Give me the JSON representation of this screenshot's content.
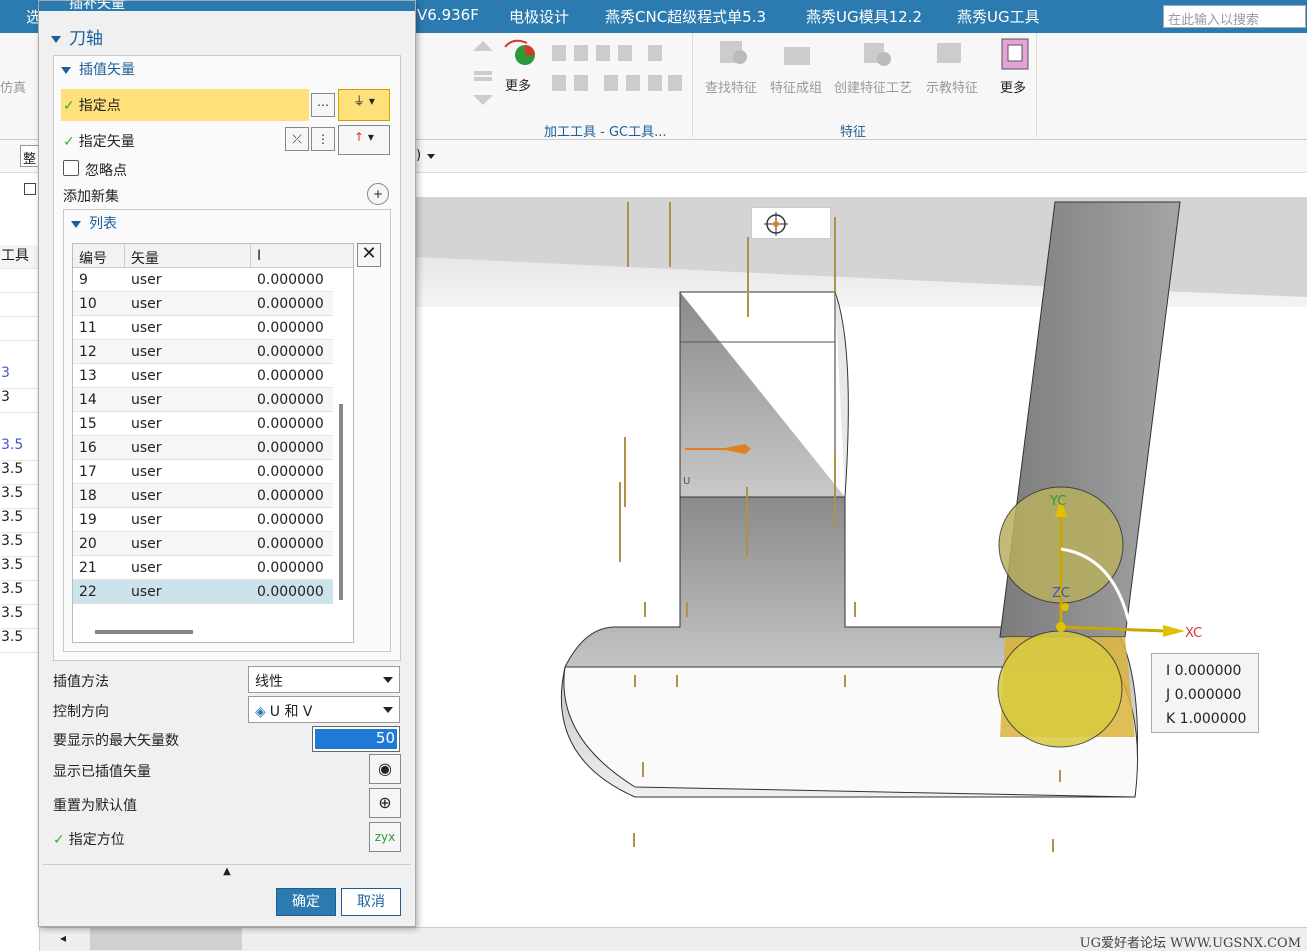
{
  "menubar": {
    "left_partial": "选",
    "items": [
      "V6.936F",
      "电极设计",
      "燕秀CNC超级程式单5.3",
      "燕秀UG模具12.2",
      "燕秀UG工具"
    ],
    "search_placeholder": "在此输入以搜索"
  },
  "ribbon": {
    "left_partial_label": "仿真",
    "more_label": "更多",
    "group_machining": "加工工具 - GC工具...",
    "feature_buttons": [
      "查找特征",
      "特征成组",
      "创建特征工艺",
      "示教特征"
    ],
    "feature_more": "更多",
    "group_feature": "特征"
  },
  "toolbar2": {
    "partial_label": "整",
    "right_partial": ")"
  },
  "left_strip": {
    "header": "工具",
    "values": [
      "3",
      "3",
      "3.5",
      "3.5",
      "3.5",
      "3.5",
      "3.5",
      "3.5",
      "3.5",
      "3.5",
      "3.5"
    ]
  },
  "dialog": {
    "title": "插补矢量",
    "section_tool_axis": "刀轴",
    "section_interp": "插值矢量",
    "specify_point": "指定点",
    "specify_vector": "指定矢量",
    "ignore_point": "忽略点",
    "add_new_set": "添加新集",
    "list_label": "列表",
    "columns": [
      "编号",
      "矢量",
      "I"
    ],
    "rows": [
      {
        "no": "9",
        "vec": "user",
        "i": "0.000000"
      },
      {
        "no": "10",
        "vec": "user",
        "i": "0.000000"
      },
      {
        "no": "11",
        "vec": "user",
        "i": "0.000000"
      },
      {
        "no": "12",
        "vec": "user",
        "i": "0.000000"
      },
      {
        "no": "13",
        "vec": "user",
        "i": "0.000000"
      },
      {
        "no": "14",
        "vec": "user",
        "i": "0.000000"
      },
      {
        "no": "15",
        "vec": "user",
        "i": "0.000000"
      },
      {
        "no": "16",
        "vec": "user",
        "i": "0.000000"
      },
      {
        "no": "17",
        "vec": "user",
        "i": "0.000000"
      },
      {
        "no": "18",
        "vec": "user",
        "i": "0.000000"
      },
      {
        "no": "19",
        "vec": "user",
        "i": "0.000000"
      },
      {
        "no": "20",
        "vec": "user",
        "i": "0.000000"
      },
      {
        "no": "21",
        "vec": "user",
        "i": "0.000000"
      },
      {
        "no": "22",
        "vec": "user",
        "i": "0.000000"
      }
    ],
    "selected_row": "22",
    "interp_method_label": "插值方法",
    "interp_method_value": "线性",
    "control_dir_label": "控制方向",
    "control_dir_value": "U 和 V",
    "max_vectors_label": "要显示的最大矢量数",
    "max_vectors_value": "50",
    "show_interp_label": "显示已插值矢量",
    "reset_label": "重置为默认值",
    "specify_orient_label": "指定方位",
    "ok": "确定",
    "cancel": "取消"
  },
  "viewport": {
    "axis_labels": {
      "yc": "YC",
      "zc": "ZC",
      "xc": "XC",
      "u": "U"
    },
    "ijk": {
      "i": "I  0.000000",
      "j": "J  0.000000",
      "k": "K  1.000000"
    }
  },
  "status": {
    "watermark": "UG爱好者论坛 WWW.UGSNX.COM"
  },
  "colors": {
    "accent": "#2b7ab0",
    "highlight": "#ffe07a",
    "selected_row": "#cde3ec",
    "check": "#2db52d"
  }
}
